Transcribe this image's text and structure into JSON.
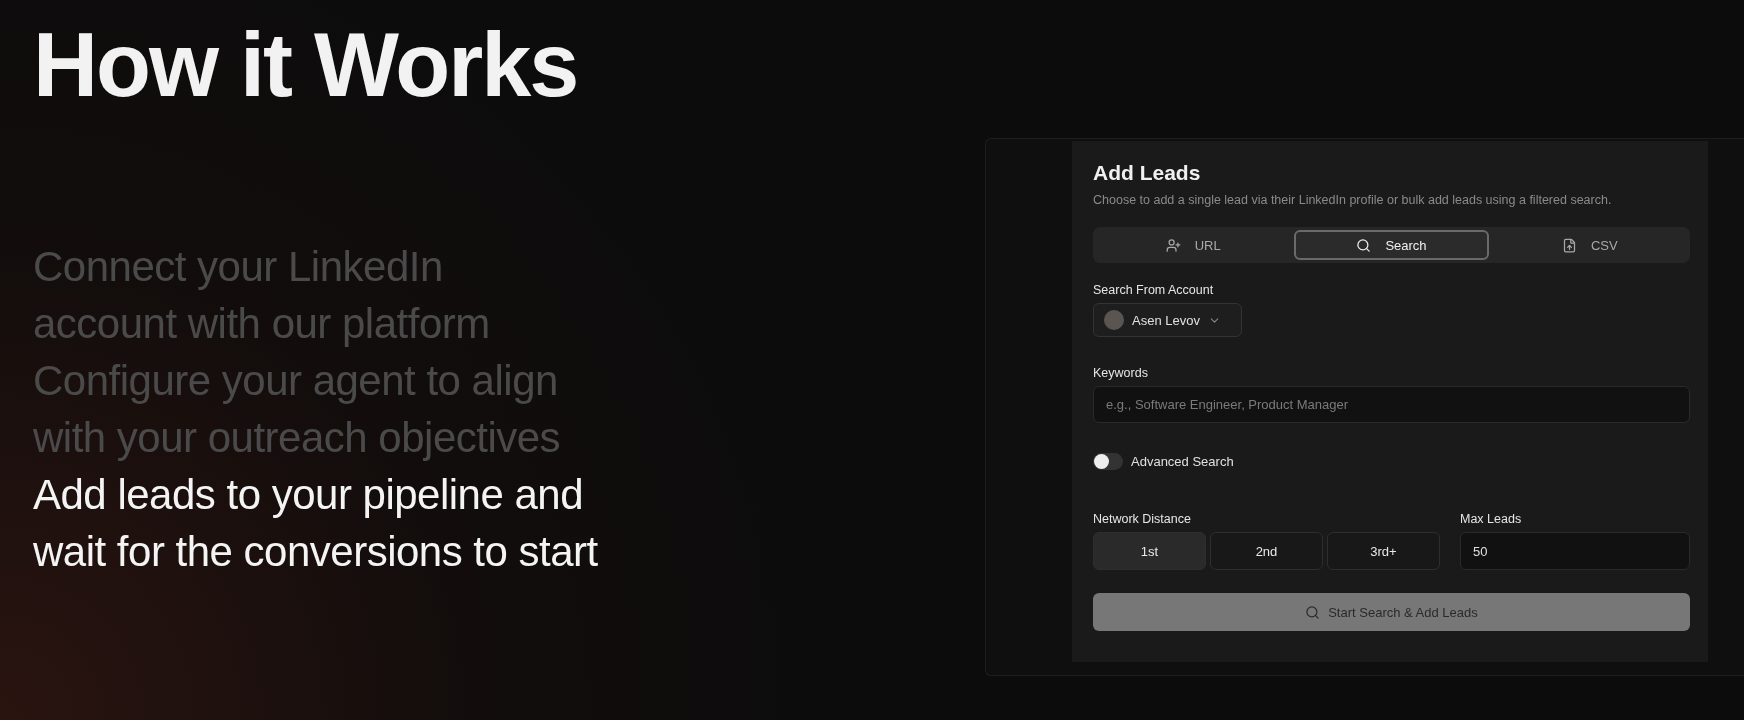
{
  "heading": "How it Works",
  "steps": [
    {
      "lines": [
        "Connect your LinkedIn",
        "account with our platform"
      ],
      "selected": false
    },
    {
      "lines": [
        "Configure your agent to align",
        "with your outreach objectives"
      ],
      "selected": false
    },
    {
      "lines": [
        "Add leads to your pipeline and",
        "wait for the conversions to start"
      ],
      "selected": true
    }
  ],
  "card": {
    "title": "Add Leads",
    "description": "Choose to add a single lead via their LinkedIn profile or bulk add leads using a filtered search.",
    "tabs": [
      {
        "label": "URL",
        "kind": "user",
        "selected": false
      },
      {
        "label": "Search",
        "kind": "search",
        "selected": true
      },
      {
        "label": "CSV",
        "kind": "file",
        "selected": false
      }
    ],
    "account": {
      "label": "Search From Account",
      "value": "Asen Levov"
    },
    "keywords": {
      "label": "Keywords",
      "placeholder": "e.g., Software Engineer, Product Manager"
    },
    "advanced_search": {
      "label": "Advanced Search",
      "on": false
    },
    "network_distance": {
      "label": "Network Distance",
      "options": [
        {
          "label": "1st",
          "selected": true
        },
        {
          "label": "2nd",
          "selected": false
        },
        {
          "label": "3rd+",
          "selected": false
        }
      ]
    },
    "max_leads": {
      "label": "Max Leads",
      "value": "50"
    },
    "submit": {
      "label": "Start Search & Add Leads",
      "disabled": true
    }
  }
}
